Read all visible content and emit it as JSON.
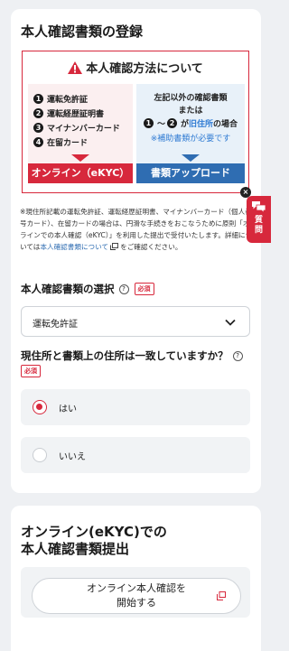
{
  "section1": {
    "title": "本人確認書類の登録",
    "notice": {
      "title": "本人確認方法について",
      "left_items": [
        "運転免許証",
        "運転経歴証明書",
        "マイナンバーカード",
        "在留カード"
      ],
      "left_numbers": [
        "1",
        "2",
        "3",
        "4"
      ],
      "left_button": "オンライン（eKYC）",
      "right_line1": "左記以外の確認書類",
      "right_line2": "または",
      "right_line3_prefix": "〜",
      "right_line3_mid": "が",
      "right_line3_old": "旧住所",
      "right_line3_suffix": "の場合",
      "right_num1": "1",
      "right_num2": "2",
      "right_note": "※補助書類が必要です",
      "right_button": "書類アップロード"
    },
    "note": {
      "text": "※現住所記載の運転免許証、運転経歴証明書、マイナンバーカード（個人番号カード）、在留カードの場合は、円滑な手続きをおこなうために原則「オンラインでの本人確認（eKYC）」を利用した提出で受付いたします。詳細については",
      "link": "本人確認書類について",
      "suffix": "をご確認ください。"
    },
    "select_label": "本人確認書類の選択",
    "required": "必須",
    "select_value": "運転免許証",
    "address_question": "現住所と書類上の住所は一致していますか？",
    "options": [
      "はい",
      "いいえ"
    ]
  },
  "section2": {
    "title_line1": "オンライン(eKYC)での",
    "title_line2": "本人確認書類提出",
    "button_line1": "オンライン本人確認を",
    "button_line2": "開始する"
  },
  "fab": {
    "label_line1": "質",
    "label_line2": "問",
    "close": "×"
  },
  "colors": {
    "accent_red": "#d7283c",
    "accent_blue": "#2f6db2",
    "link_blue": "#2f7bd3"
  }
}
